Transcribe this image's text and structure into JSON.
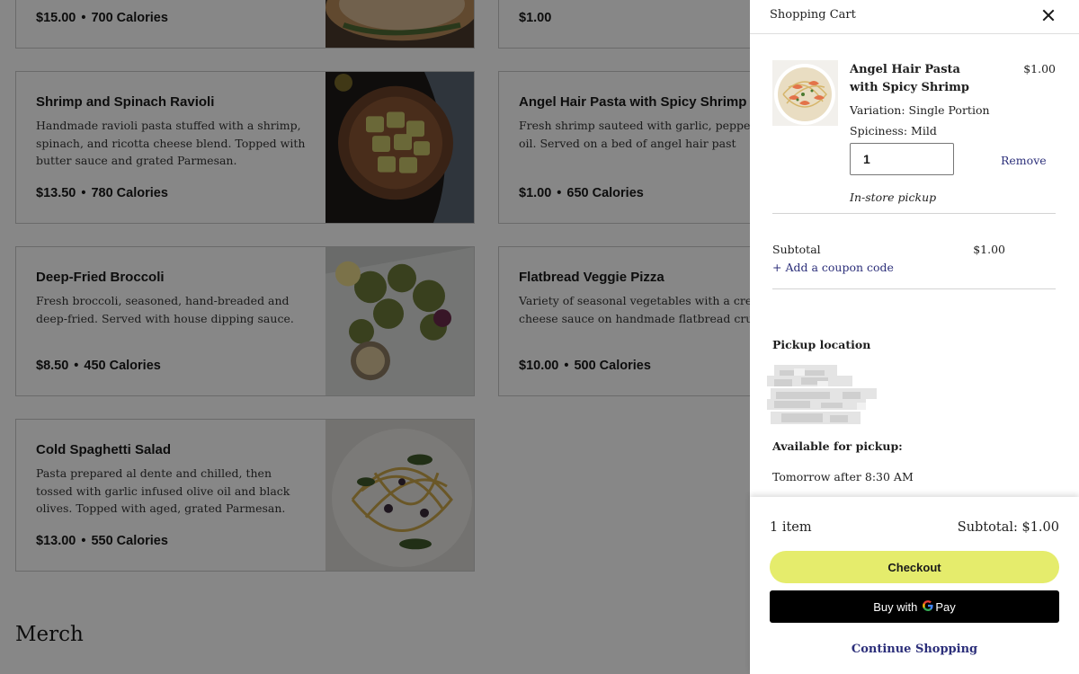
{
  "menu": {
    "items": [
      {
        "name": "",
        "description": "",
        "price": "$15.00",
        "calories": "700 Calories"
      },
      {
        "name": "",
        "description": "",
        "price": "$1.00",
        "calories": ""
      },
      {
        "name": "Shrimp and Spinach Ravioli",
        "description": "Handmade ravioli pasta stuffed with a shrimp, spinach, and ricotta cheese blend. Topped with butter sauce and grated Parmesan.",
        "price": "$13.50",
        "calories": "780 Calories"
      },
      {
        "name": "Angel Hair Pasta with Spicy Shrimp",
        "description": "Fresh shrimp sauteed with garlic, peppers, olive oil. Served on a bed of angel hair past",
        "price": "$1.00",
        "calories": "650 Calories"
      },
      {
        "name": "Deep-Fried Broccoli",
        "description": "Fresh broccoli, seasoned, hand-breaded and deep-fried. Served with house dipping sauce.",
        "price": "$8.50",
        "calories": "450 Calories"
      },
      {
        "name": "Flatbread Veggie Pizza",
        "description": "Variety of seasonal vegetables with a crear cheese sauce on handmade flatbread crust",
        "price": "$10.00",
        "calories": "500 Calories"
      },
      {
        "name": "Cold Spaghetti Salad",
        "description": "Pasta prepared al dente and chilled, then tossed with garlic infused olive oil and black olives. Topped with aged, grated Parmesan.",
        "price": "$13.00",
        "calories": "550 Calories"
      }
    ],
    "section_heading": "Merch",
    "bullet": "•"
  },
  "cart": {
    "title": "Shopping Cart",
    "item": {
      "name": "Angel Hair Pasta with Spicy Shrimp",
      "price": "$1.00",
      "variation": "Variation: Single Portion",
      "spiciness": "Spiciness: Mild",
      "quantity": "1",
      "remove_label": "Remove",
      "fulfillment": "In-store pickup"
    },
    "subtotal_label": "Subtotal",
    "subtotal_value": "$1.00",
    "coupon_link": "+ Add a coupon code",
    "pickup_location_label": "Pickup location",
    "available_label": "Available for pickup:",
    "pickup_time": "Tomorrow after 8:30 AM"
  },
  "footer": {
    "item_count": "1 item",
    "subtotal_label": "Subtotal:",
    "subtotal_value": "$1.00",
    "checkout_label": "Checkout",
    "gpay_prefix": "Buy with",
    "gpay_suffix": "Pay",
    "continue_label": "Continue Shopping"
  },
  "colors": {
    "checkout_button": "#e5ec6c",
    "link": "#2c2f7a",
    "overlay": "rgba(0,0,0,0.47)"
  },
  "icons": {
    "close": "close-icon",
    "google": "google-g-icon"
  }
}
